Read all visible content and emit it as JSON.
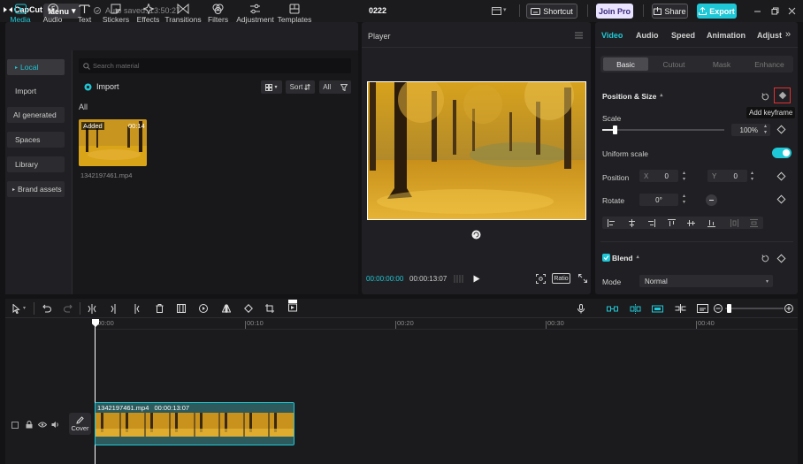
{
  "app": {
    "logo_text": "CapCut",
    "menu_label": "Menu",
    "autosave_text": "Auto saved: 13:50:27",
    "project_title": "0222",
    "shortcut_label": "Shortcut",
    "join_pro_label": "Join Pro",
    "share_label": "Share",
    "export_label": "Export"
  },
  "media_tabs": [
    {
      "label": "Media",
      "icon": "media-icon"
    },
    {
      "label": "Audio",
      "icon": "audio-icon"
    },
    {
      "label": "Text",
      "icon": "text-icon"
    },
    {
      "label": "Stickers",
      "icon": "sticker-icon"
    },
    {
      "label": "Effects",
      "icon": "effects-icon"
    },
    {
      "label": "Transitions",
      "icon": "transitions-icon"
    },
    {
      "label": "Filters",
      "icon": "filters-icon"
    },
    {
      "label": "Adjustment",
      "icon": "adjustment-icon"
    },
    {
      "label": "Templates",
      "icon": "templates-icon"
    }
  ],
  "left_nav": [
    "Local",
    "Import",
    "AI generated",
    "Spaces",
    "Library",
    "Brand assets"
  ],
  "media": {
    "search_placeholder": "Search material",
    "import_label": "Import",
    "sort_label": "Sort",
    "all_filter_label": "All",
    "all_section_label": "All",
    "clip": {
      "added_badge": "Added",
      "duration": "00:14",
      "filename": "1342197461.mp4"
    }
  },
  "player": {
    "title": "Player",
    "timecode_current": "00:00:00:00",
    "timecode_total": "00:00:13:07",
    "ratio_label": "Ratio"
  },
  "properties": {
    "tabs": [
      "Video",
      "Audio",
      "Speed",
      "Animation",
      "Adjust"
    ],
    "subtabs": [
      "Basic",
      "Cutout",
      "Mask",
      "Enhance"
    ],
    "section_position_size": "Position & Size",
    "scale_label": "Scale",
    "scale_value": "100%",
    "scale_level": 0.1,
    "uniform_scale_label": "Uniform scale",
    "uniform_scale_on": true,
    "position_label": "Position",
    "pos_x_label": "X",
    "pos_x_value": "0",
    "pos_y_label": "Y",
    "pos_y_value": "0",
    "rotate_label": "Rotate",
    "rotate_value": "0°",
    "blend_label": "Blend",
    "mode_label": "Mode",
    "mode_value": "Normal",
    "add_keyframe_tooltip": "Add keyframe"
  },
  "timeline": {
    "ticks": [
      "00:00",
      "00:10",
      "00:20",
      "00:30",
      "00:40"
    ],
    "clip_label": "1342197461.mp4",
    "clip_duration": "00:00:13:07",
    "cover_label": "Cover"
  },
  "colors": {
    "accent": "#1fc8d6",
    "background": "#131316",
    "panel": "#202024",
    "highlight_red": "#e03030"
  }
}
